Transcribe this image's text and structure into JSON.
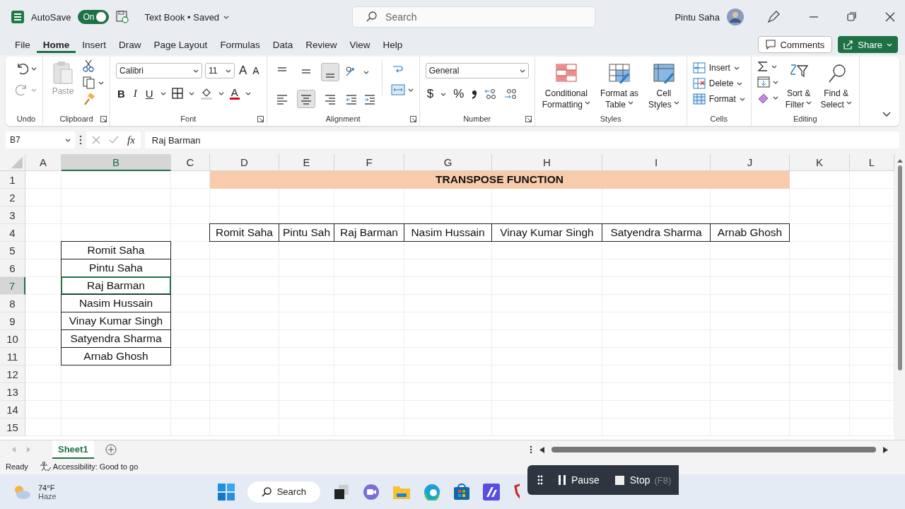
{
  "title_bar": {
    "autosave": {
      "label": "AutoSave",
      "on": true,
      "state_label": "On"
    },
    "document": "Text Book • Saved",
    "search": {
      "placeholder": "Search"
    },
    "user": "Pintu Saha"
  },
  "menu_tabs": [
    {
      "label": "File",
      "selected": false
    },
    {
      "label": "Home",
      "selected": true
    },
    {
      "label": "Insert",
      "selected": false
    },
    {
      "label": "Draw",
      "selected": false
    },
    {
      "label": "Page Layout",
      "selected": false
    },
    {
      "label": "Formulas",
      "selected": false
    },
    {
      "label": "Data",
      "selected": false
    },
    {
      "label": "Review",
      "selected": false
    },
    {
      "label": "View",
      "selected": false
    },
    {
      "label": "Help",
      "selected": false
    }
  ],
  "actions": {
    "comments": "Comments",
    "share": "Share"
  },
  "ribbon": {
    "groups": [
      {
        "kind": "undo",
        "label": "Undo"
      },
      {
        "kind": "clipboard",
        "label": "Clipboard",
        "paste": "Paste"
      },
      {
        "kind": "font",
        "label": "Font",
        "font": "Calibri",
        "size": "11",
        "grow": "A",
        "shrink": "A",
        "bold": "B",
        "italic": "I",
        "underline": "U",
        "font_color": "A"
      },
      {
        "kind": "alignment",
        "label": "Alignment",
        "vertical": [
          {
            "selected": false
          },
          {
            "selected": false
          },
          {
            "selected": true
          }
        ],
        "horizontal": [
          {
            "selected": false
          },
          {
            "selected": true
          },
          {
            "selected": false
          }
        ]
      },
      {
        "kind": "number",
        "label": "Number",
        "format": "General",
        "currency": "$",
        "percent": "%"
      },
      {
        "kind": "styles",
        "label": "Styles",
        "buttons": [
          {
            "lines": [
              "Conditional",
              "Formatting"
            ]
          },
          {
            "lines": [
              "Format as",
              "Table"
            ]
          },
          {
            "lines": [
              "Cell",
              "Styles"
            ]
          }
        ]
      },
      {
        "kind": "cells",
        "label": "Cells",
        "buttons": [
          "Insert",
          "Delete",
          "Format"
        ]
      },
      {
        "kind": "editing",
        "label": "Editing",
        "buttons": [
          {
            "lines": [
              "Sort &",
              "Filter"
            ]
          },
          {
            "lines": [
              "Find &",
              "Select"
            ]
          }
        ]
      }
    ]
  },
  "formula_bar": {
    "name_box": "B7",
    "fx": "fx",
    "value": "Raj Barman"
  },
  "sheet": {
    "columns": [
      {
        "label": "A",
        "selected": false
      },
      {
        "label": "B",
        "selected": true
      },
      {
        "label": "C",
        "selected": false
      },
      {
        "label": "D",
        "selected": false
      },
      {
        "label": "E",
        "selected": false
      },
      {
        "label": "F",
        "selected": false
      },
      {
        "label": "G",
        "selected": false
      },
      {
        "label": "H",
        "selected": false
      },
      {
        "label": "I",
        "selected": false
      },
      {
        "label": "J",
        "selected": false
      },
      {
        "label": "K",
        "selected": false
      },
      {
        "label": "L",
        "selected": false
      }
    ],
    "rows": [
      {
        "label": "1",
        "selected": false,
        "cells": [
          null,
          null,
          null,
          {
            "kind": "title",
            "text": "TRANSPOSE FUNCTION",
            "selected": false
          },
          null,
          null,
          null,
          null,
          null,
          null
        ]
      },
      {
        "label": "2",
        "selected": false
      },
      {
        "label": "3",
        "selected": false
      },
      {
        "label": "4",
        "selected": false,
        "cells": [
          null,
          null,
          null,
          {
            "kind": "boxed",
            "text": "Romit Saha",
            "selected": false
          },
          {
            "kind": "boxed",
            "text": "Pintu Sah",
            "selected": false
          },
          {
            "kind": "boxed",
            "text": "Raj Barman",
            "selected": false
          },
          {
            "kind": "boxed",
            "text": "Nasim Hussain",
            "selected": false
          },
          {
            "kind": "boxed",
            "text": "Vinay Kumar Singh",
            "selected": false
          },
          {
            "kind": "boxed",
            "text": "Satyendra Sharma",
            "selected": false
          },
          {
            "kind": "boxed",
            "text": "Arnab Ghosh",
            "selected": false
          }
        ]
      },
      {
        "label": "5",
        "selected": false,
        "cells": [
          null,
          {
            "kind": "boxed",
            "text": "Romit Saha",
            "selected": false
          }
        ]
      },
      {
        "label": "6",
        "selected": false,
        "cells": [
          null,
          {
            "kind": "boxed",
            "text": "Pintu Saha",
            "selected": false
          }
        ]
      },
      {
        "label": "7",
        "selected": true,
        "cells": [
          null,
          {
            "kind": "boxed",
            "text": "Raj Barman",
            "selected": true
          }
        ]
      },
      {
        "label": "8",
        "selected": false,
        "cells": [
          null,
          {
            "kind": "boxed",
            "text": "Nasim Hussain",
            "selected": false
          }
        ]
      },
      {
        "label": "9",
        "selected": false,
        "cells": [
          null,
          {
            "kind": "boxed",
            "text": "Vinay Kumar Singh",
            "selected": false
          }
        ]
      },
      {
        "label": "10",
        "selected": false,
        "cells": [
          null,
          {
            "kind": "boxed",
            "text": "Satyendra Sharma",
            "selected": false
          }
        ]
      },
      {
        "label": "11",
        "selected": false,
        "cells": [
          null,
          {
            "kind": "boxed",
            "text": "Arnab Ghosh",
            "selected": false
          }
        ]
      },
      {
        "label": "12",
        "selected": false
      },
      {
        "label": "13",
        "selected": false
      },
      {
        "label": "14",
        "selected": false
      },
      {
        "label": "15",
        "selected": false
      }
    ]
  },
  "sheet_tabs": [
    {
      "label": "Sheet1",
      "selected": true
    }
  ],
  "status_bar": {
    "mode": "Ready",
    "accessibility": "Accessibility: Good to go"
  },
  "taskbar": {
    "weather": {
      "temp": "74°F",
      "condition": "Haze"
    },
    "search": "Search"
  },
  "recorder": {
    "pause": "Pause",
    "stop": "Stop",
    "stop_key": "(F8)"
  }
}
